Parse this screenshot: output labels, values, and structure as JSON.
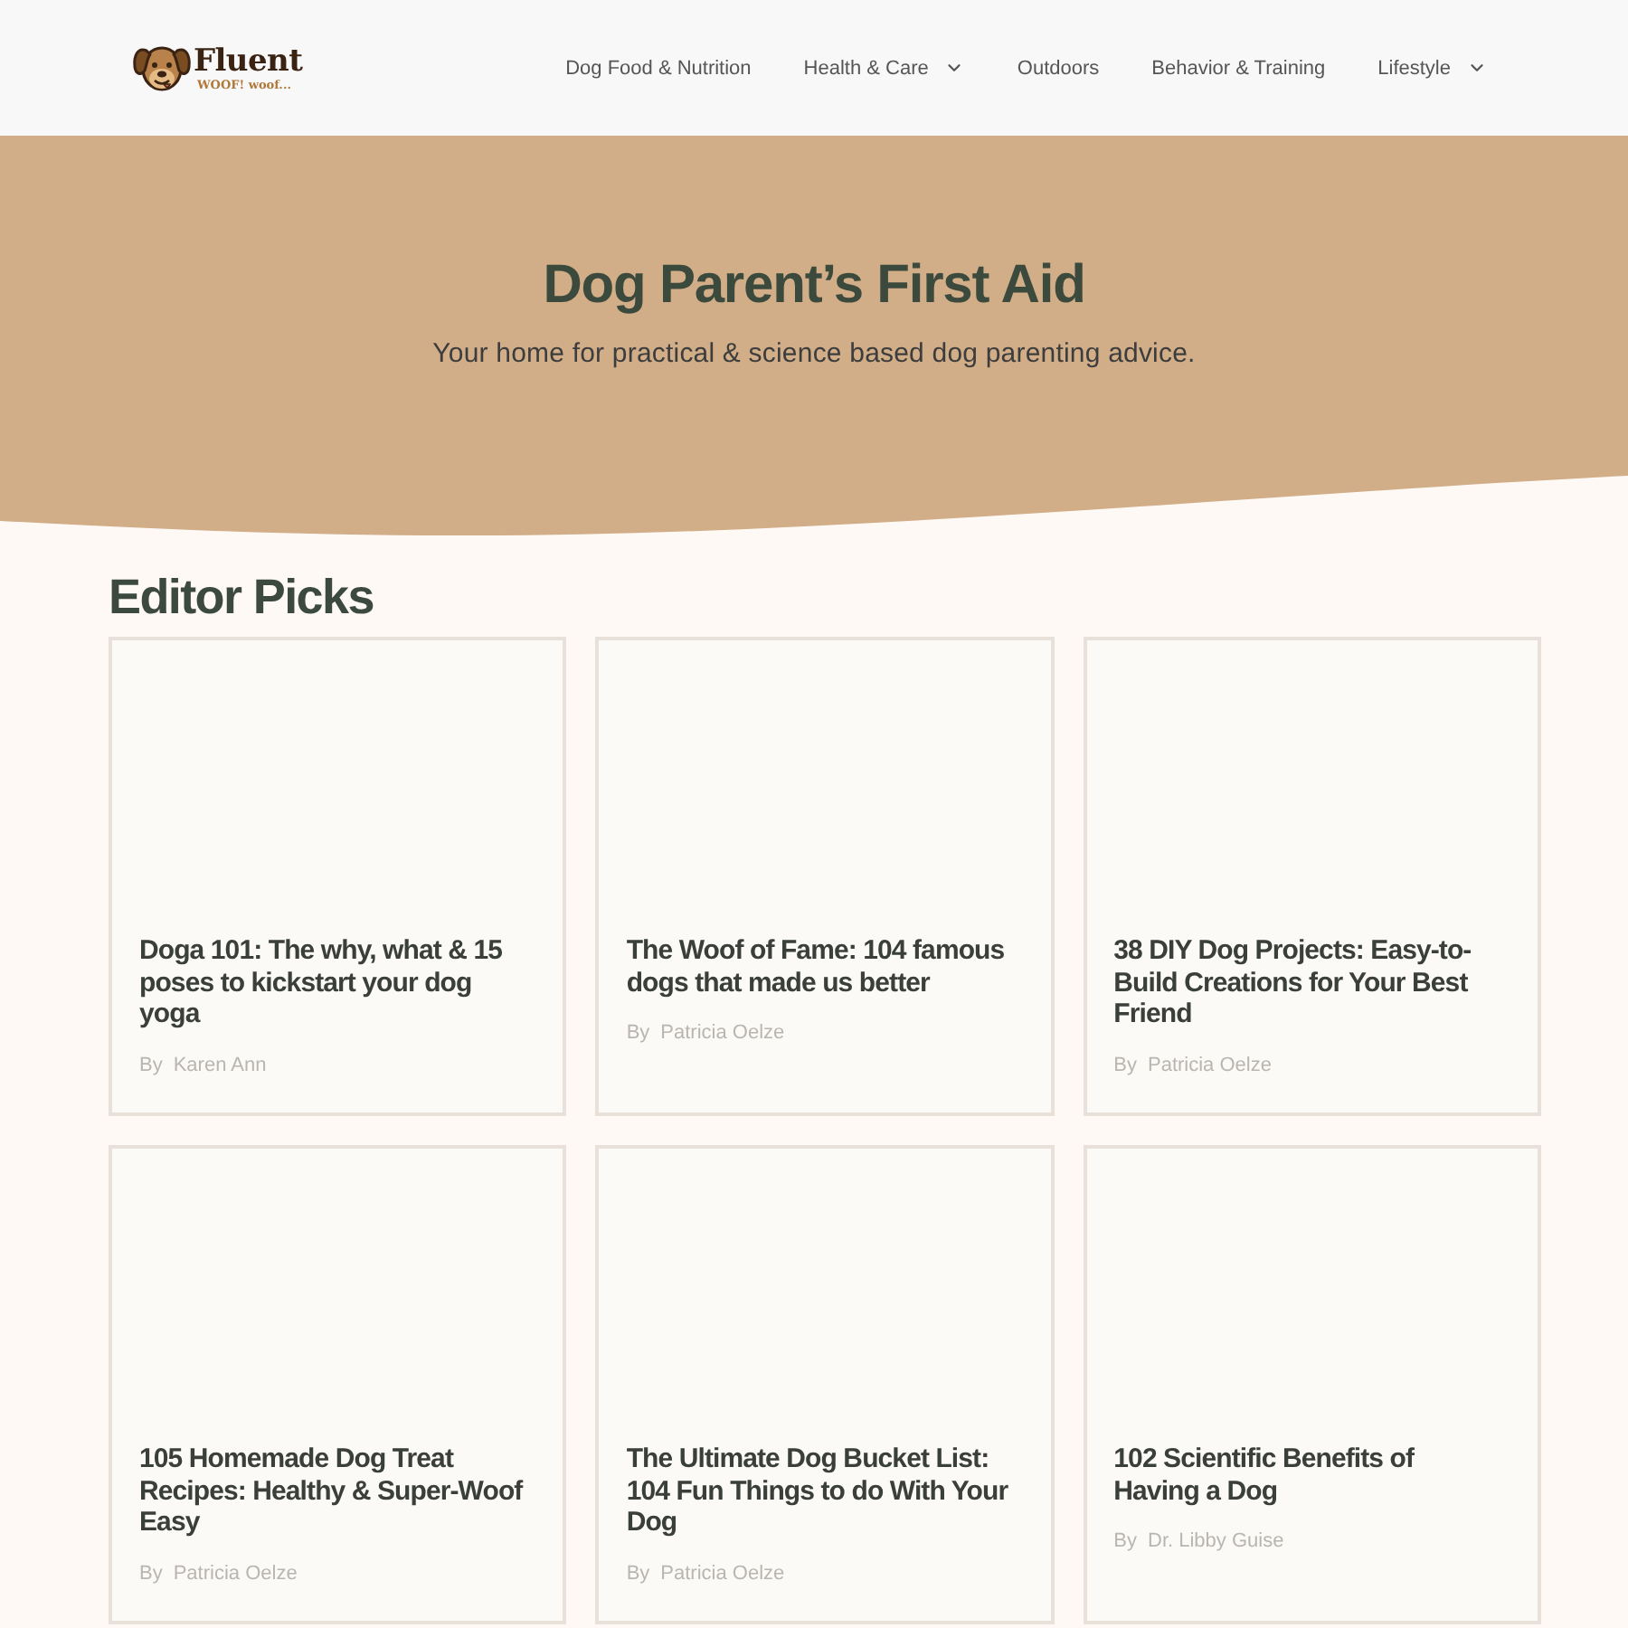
{
  "header": {
    "logo": {
      "name": "Fluent",
      "tagline": "WOOF! woof..."
    },
    "nav": [
      {
        "label": "Dog Food & Nutrition",
        "dropdown": false
      },
      {
        "label": "Health & Care",
        "dropdown": true
      },
      {
        "label": "Outdoors",
        "dropdown": false
      },
      {
        "label": "Behavior & Training",
        "dropdown": false
      },
      {
        "label": "Lifestyle",
        "dropdown": true
      }
    ]
  },
  "hero": {
    "title": "Dog Parent’s First Aid",
    "subtitle": "Your home for practical & science based dog parenting advice."
  },
  "editor_picks": {
    "heading": "Editor Picks",
    "articles": [
      {
        "title": "Doga 101: The why, what & 15 poses to kickstart your dog yoga",
        "byline": "By",
        "author": "Karen Ann"
      },
      {
        "title": "The Woof of Fame: 104 famous dogs that made us better",
        "byline": "By",
        "author": "Patricia Oelze"
      },
      {
        "title": "38 DIY Dog Projects: Easy-to-Build Creations for Your Best Friend",
        "byline": "By",
        "author": "Patricia Oelze"
      },
      {
        "title": "105 Homemade Dog Treat Recipes: Healthy & Super-Woof Easy",
        "byline": "By",
        "author": "Patricia Oelze"
      },
      {
        "title": "The Ultimate Dog Bucket List: 104 Fun Things to do With Your Dog",
        "byline": "By",
        "author": "Patricia Oelze"
      },
      {
        "title": "102 Scientific Benefits of Having a Dog",
        "byline": "By",
        "author": "Dr. Libby Guise"
      }
    ]
  }
}
